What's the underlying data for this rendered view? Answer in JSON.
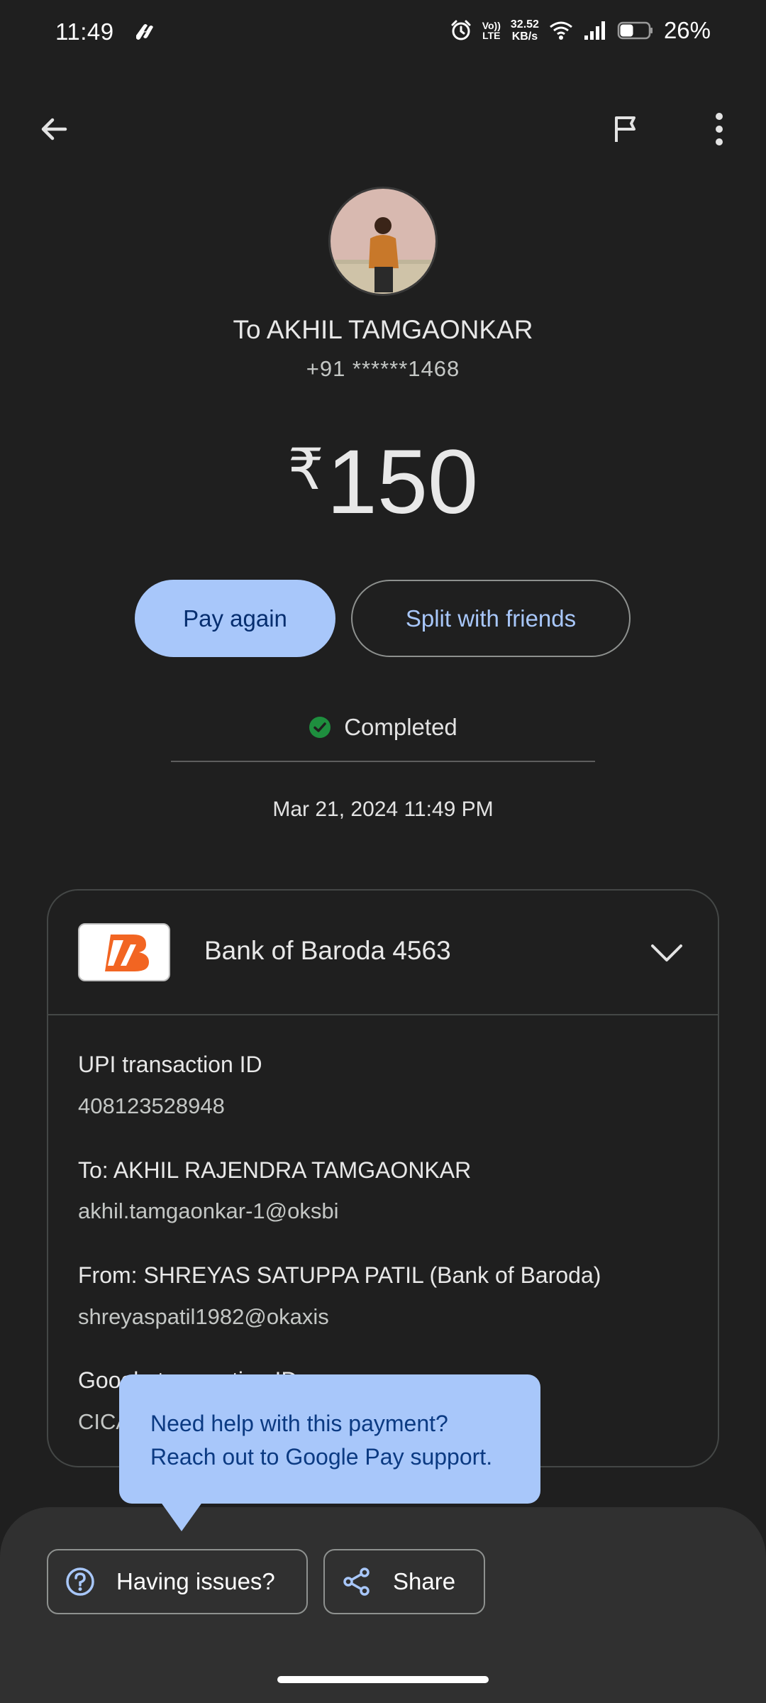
{
  "status_bar": {
    "time": "11:49",
    "volte_top": "Vo))",
    "volte_bottom": "LTE",
    "net_speed_value": "32.52",
    "net_speed_unit": "KB/s",
    "battery": "26%"
  },
  "recipient": {
    "name": "To AKHIL TAMGAONKAR",
    "phone": "+91 ******1468"
  },
  "amount": {
    "currency": "₹",
    "value": "150"
  },
  "actions": {
    "pay_again": "Pay again",
    "split": "Split with friends"
  },
  "status": {
    "label": "Completed",
    "datetime": "Mar 21, 2024 11:49 PM",
    "color": "#1e8e3e"
  },
  "details": {
    "bank": "Bank of Baroda 4563",
    "items": [
      {
        "label": "UPI transaction ID",
        "value": "408123528948"
      },
      {
        "label": "To: AKHIL RAJENDRA TAMGAONKAR",
        "value": "akhil.tamgaonkar-1@oksbi"
      },
      {
        "label": "From: SHREYAS SATUPPA PATIL (Bank of Baroda)",
        "value": "shreyaspatil1982@okaxis"
      },
      {
        "label": "Google transaction ID",
        "value": "CICA"
      }
    ]
  },
  "tooltip": {
    "line1": "Need help with this payment?",
    "line2": "Reach out to Google Pay support."
  },
  "bottom": {
    "issues": "Having issues?",
    "share": "Share"
  },
  "colors": {
    "background": "#1f1f1f",
    "accent": "#a8c7fa",
    "bank_brand": "#f26522"
  }
}
